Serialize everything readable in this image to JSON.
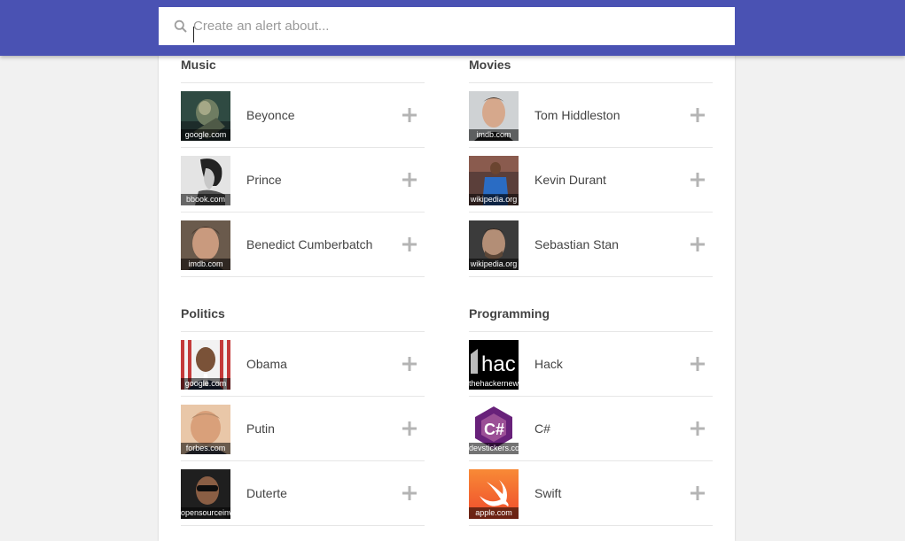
{
  "search": {
    "placeholder": "Create an alert about..."
  },
  "sections": [
    {
      "title": "Music",
      "items": [
        {
          "label": "Beyonce",
          "source": "google.com"
        },
        {
          "label": "Prince",
          "source": "bbook.com"
        },
        {
          "label": "Benedict Cumberbatch",
          "source": "imdb.com"
        }
      ]
    },
    {
      "title": "Movies",
      "items": [
        {
          "label": "Tom Hiddleston",
          "source": "imdb.com"
        },
        {
          "label": "Kevin Durant",
          "source": "wikipedia.org"
        },
        {
          "label": "Sebastian Stan",
          "source": "wikipedia.org"
        }
      ]
    },
    {
      "title": "Politics",
      "items": [
        {
          "label": "Obama",
          "source": "google.com"
        },
        {
          "label": "Putin",
          "source": "forbes.com"
        },
        {
          "label": "Duterte",
          "source": "opensourceinv"
        }
      ]
    },
    {
      "title": "Programming",
      "items": [
        {
          "label": "Hack",
          "source": "thehackernew",
          "logo_text": "hac"
        },
        {
          "label": "C#",
          "source": "devstickers.co",
          "logo_text": "C#"
        },
        {
          "label": "Swift",
          "source": "apple.com"
        }
      ]
    }
  ],
  "icons": {
    "search": "search-icon",
    "add": "plus-icon"
  },
  "colors": {
    "header": "#4a52b3",
    "plus": "#b4b4b4",
    "csharp": "#68217a",
    "swift": "#f05138"
  }
}
